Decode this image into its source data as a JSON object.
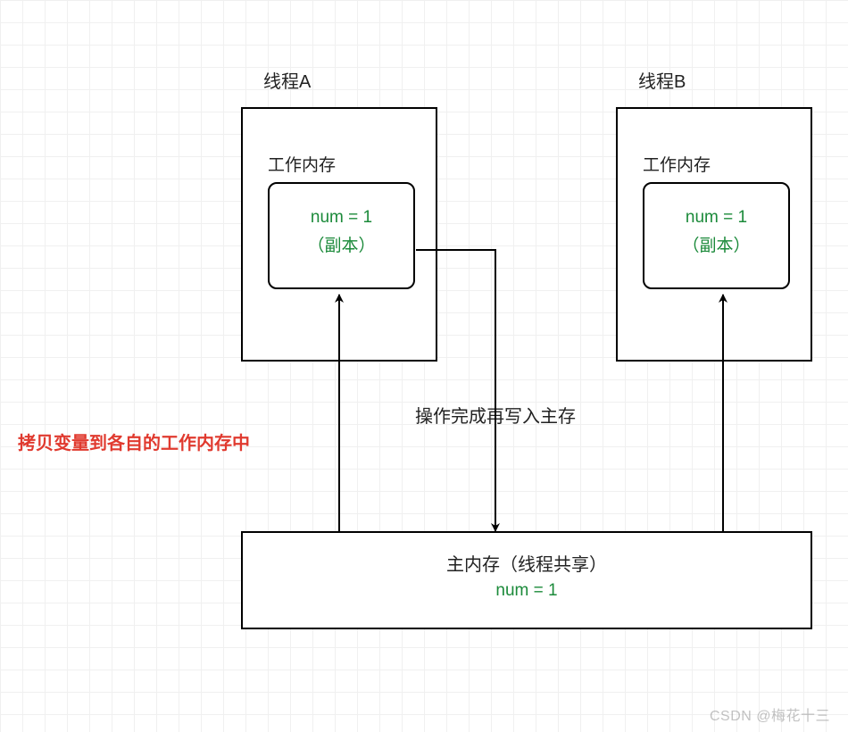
{
  "threadA": {
    "title": "线程A",
    "workmem_label": "工作内存",
    "num_label": "num = 1",
    "copy_label": "（副本）"
  },
  "threadB": {
    "title": "线程B",
    "workmem_label": "工作内存",
    "num_label": "num = 1",
    "copy_label": "（副本）"
  },
  "main_memory": {
    "title": "主内存（线程共享）",
    "num_label": "num = 1"
  },
  "annotations": {
    "copy_note": "拷贝变量到各自的工作内存中",
    "writeback_note": "操作完成再写入主存"
  },
  "watermark": "CSDN @梅花十三",
  "colors": {
    "green": "#1b8a3a",
    "red": "#e03a2f",
    "border": "#000000",
    "grid": "#f0f0f0"
  }
}
